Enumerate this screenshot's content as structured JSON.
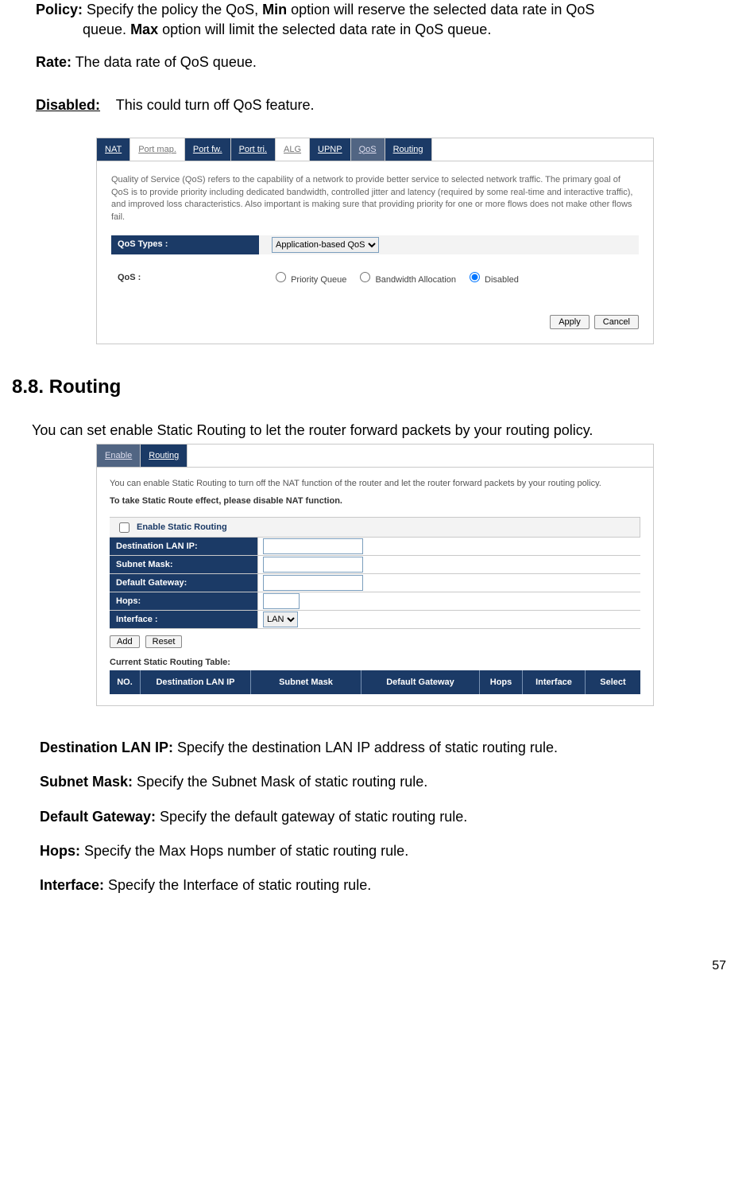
{
  "top": {
    "policy_label": "Policy:",
    "policy_text_1": " Specify the policy the QoS, ",
    "min_bold": "Min",
    "policy_text_2": " option will reserve the selected data rate in QoS",
    "policy_line2_a": "queue. ",
    "max_bold": "Max",
    "policy_line2_b": " option will limit the selected data rate in QoS queue.",
    "rate_label": "Rate:",
    "rate_text": " The data rate of QoS queue.",
    "disabled_label": "Disabled:",
    "disabled_text": "    This could turn off QoS feature."
  },
  "qos_shot": {
    "tabs": {
      "nat": "NAT",
      "portmap": "Port map.",
      "portfw": "Port fw.",
      "porttri": "Port tri.",
      "alg": "ALG",
      "upnp": "UPNP",
      "qos": "QoS",
      "routing": "Routing"
    },
    "desc": "Quality of Service (QoS) refers to the capability of a network to provide better service to selected network traffic. The primary goal of QoS is to provide priority including dedicated bandwidth, controlled jitter and latency (required by some real-time and interactive traffic), and improved loss characteristics. Also important is making sure that providing priority for one or more flows does not make other flows fail.",
    "qos_types_label": "QoS Types :",
    "qos_types_value": "Application-based QoS",
    "qos_label": "QoS :",
    "radio1": "Priority Queue",
    "radio2": "Bandwidth Allocation",
    "radio3": "Disabled",
    "apply": "Apply",
    "cancel": "Cancel"
  },
  "section_title": "8.8. Routing",
  "section_intro": "You can set enable Static Routing to let the router forward packets by your routing policy.",
  "routing_shot": {
    "tabs": {
      "enable": "Enable",
      "routing": "Routing"
    },
    "desc": "You can enable Static Routing to turn off the NAT function of the router and let the router forward packets by your routing policy.",
    "note": "To take Static Route effect, please disable NAT function.",
    "checkbox_label": "Enable Static Routing",
    "fields": {
      "dest": "Destination LAN IP:",
      "subnet": "Subnet Mask:",
      "gateway": "Default Gateway:",
      "hops": "Hops:",
      "iface": "Interface :",
      "iface_val": "LAN"
    },
    "add": "Add",
    "reset": "Reset",
    "table_title": "Current Static Routing Table:",
    "cols": {
      "no": "NO.",
      "dest": "Destination LAN IP",
      "subnet": "Subnet Mask",
      "gateway": "Default Gateway",
      "hops": "Hops",
      "iface": "Interface",
      "select": "Select"
    }
  },
  "defs": {
    "dest_label": "Destination LAN IP:",
    "dest_text": " Specify the destination LAN IP address of static routing rule.",
    "subnet_label": "Subnet Mask:",
    "subnet_text": " Specify the Subnet Mask of static routing rule.",
    "gateway_label": "Default Gateway:",
    "gateway_text": " Specify the default gateway of static routing rule.",
    "hops_label": "Hops:",
    "hops_text": " Specify the Max Hops number of static routing rule.",
    "iface_label": "Interface:",
    "iface_text": " Specify the Interface of static routing rule."
  },
  "page_number": "57"
}
